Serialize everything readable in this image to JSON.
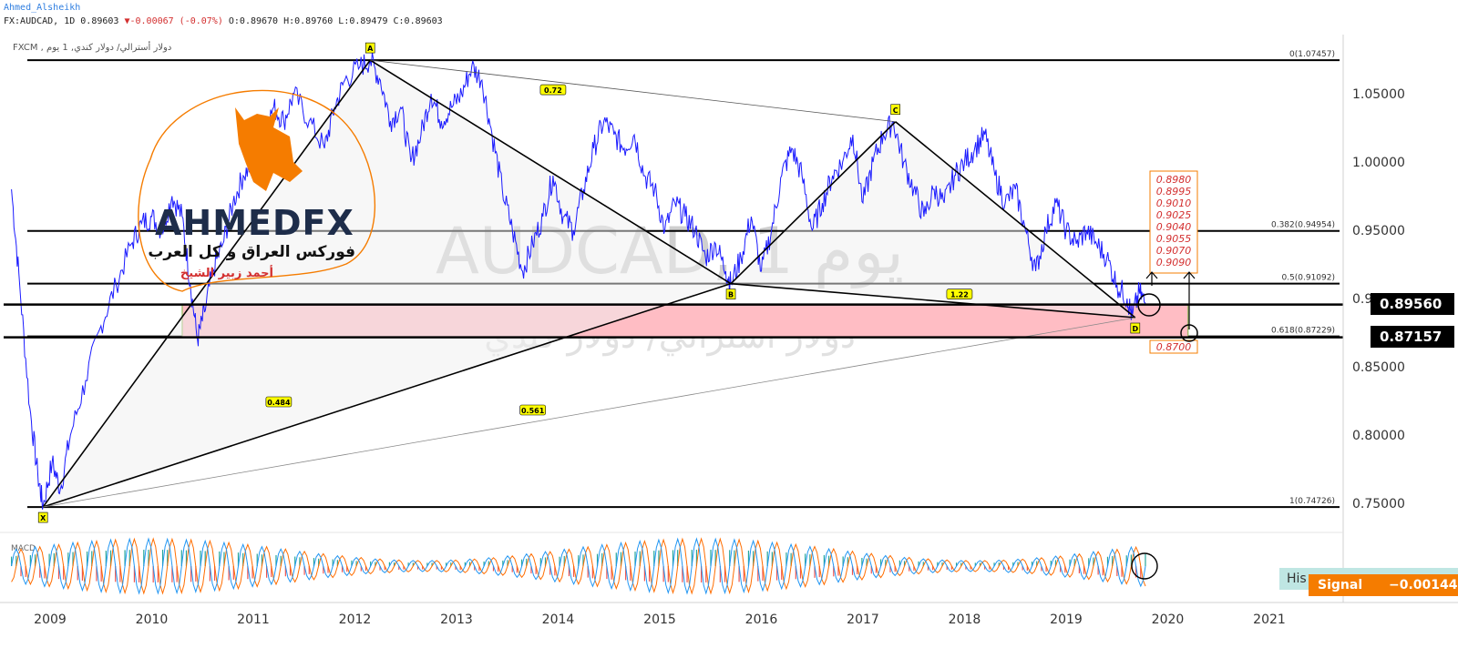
{
  "header": {
    "author": "Ahmed_Alsheikh",
    "symbol_line": "FX:AUDCAD, 1D 0.89603",
    "change_glyph": "▼",
    "change": "-0.00067 (-0.07%)",
    "ohlc": "O:0.89670 H:0.89760 L:0.89479 C:0.89603",
    "source_line": "FXCM , دولار أسترالي/ دولار كندي, 1 يوم"
  },
  "watermark": {
    "main": "AUDCAD, 1 يوم",
    "sub": "دولار أسترالي/ دولار كندي"
  },
  "logo": {
    "brand": "AHMEDFX",
    "tagline": "فوركس العراق و كل العرب",
    "name": "أحمد زبير الشيخ"
  },
  "colors": {
    "price_line": "#1a1aff",
    "zone_fill": "#ffbdc4",
    "macd_line": "#2196f3",
    "signal_line": "#ff6d00",
    "hist_up": "#26a69a",
    "hist_down": "#ef5350",
    "logo_orange": "#f57c00",
    "ratio_label_bg": "#ffff00"
  },
  "chart_data": {
    "type": "line",
    "symbol": "FX:AUDCAD",
    "timeframe": "1D",
    "x_ticks": [
      "2009",
      "2010",
      "2011",
      "2012",
      "2013",
      "2014",
      "2015",
      "2016",
      "2017",
      "2018",
      "2019",
      "2020",
      "2021"
    ],
    "y_ticks": [
      "1.05000",
      "1.00000",
      "0.95000",
      "0.90000",
      "0.85000",
      "0.80000",
      "0.75000"
    ],
    "ylim": [
      0.72,
      1.085
    ],
    "series": [
      {
        "key": "price",
        "points": [
          [
            2008.62,
            0.98
          ],
          [
            2008.7,
            0.91
          ],
          [
            2008.8,
            0.82
          ],
          [
            2008.88,
            0.77
          ],
          [
            2008.93,
            0.748
          ],
          [
            2009.02,
            0.78
          ],
          [
            2009.1,
            0.76
          ],
          [
            2009.2,
            0.8
          ],
          [
            2009.35,
            0.84
          ],
          [
            2009.5,
            0.88
          ],
          [
            2009.65,
            0.91
          ],
          [
            2009.8,
            0.94
          ],
          [
            2009.9,
            0.955
          ],
          [
            2010.0,
            0.96
          ],
          [
            2010.1,
            0.95
          ],
          [
            2010.2,
            0.975
          ],
          [
            2010.3,
            0.96
          ],
          [
            2010.38,
            0.91
          ],
          [
            2010.45,
            0.87
          ],
          [
            2010.52,
            0.89
          ],
          [
            2010.6,
            0.92
          ],
          [
            2010.7,
            0.94
          ],
          [
            2010.8,
            0.97
          ],
          [
            2010.9,
            0.99
          ],
          [
            2011.0,
            1.0
          ],
          [
            2011.1,
            1.02
          ],
          [
            2011.2,
            1.04
          ],
          [
            2011.3,
            1.03
          ],
          [
            2011.4,
            1.05
          ],
          [
            2011.55,
            1.03
          ],
          [
            2011.7,
            1.01
          ],
          [
            2011.8,
            1.04
          ],
          [
            2011.9,
            1.06
          ],
          [
            2012.05,
            1.07
          ],
          [
            2012.15,
            1.0745
          ],
          [
            2012.25,
            1.06
          ],
          [
            2012.35,
            1.03
          ],
          [
            2012.45,
            1.04
          ],
          [
            2012.55,
            1.0
          ],
          [
            2012.65,
            1.02
          ],
          [
            2012.75,
            1.05
          ],
          [
            2012.85,
            1.03
          ],
          [
            2012.95,
            1.04
          ],
          [
            2013.05,
            1.05
          ],
          [
            2013.15,
            1.07
          ],
          [
            2013.25,
            1.06
          ],
          [
            2013.35,
            1.02
          ],
          [
            2013.45,
            0.98
          ],
          [
            2013.55,
            0.95
          ],
          [
            2013.65,
            0.92
          ],
          [
            2013.75,
            0.94
          ],
          [
            2013.85,
            0.96
          ],
          [
            2013.95,
            0.99
          ],
          [
            2014.05,
            0.96
          ],
          [
            2014.15,
            0.95
          ],
          [
            2014.25,
            0.98
          ],
          [
            2014.35,
            1.01
          ],
          [
            2014.45,
            1.03
          ],
          [
            2014.55,
            1.02
          ],
          [
            2014.65,
            1.01
          ],
          [
            2014.75,
            1.02
          ],
          [
            2014.85,
            0.99
          ],
          [
            2014.95,
            0.98
          ],
          [
            2015.05,
            0.95
          ],
          [
            2015.15,
            0.97
          ],
          [
            2015.25,
            0.96
          ],
          [
            2015.35,
            0.95
          ],
          [
            2015.45,
            0.93
          ],
          [
            2015.55,
            0.94
          ],
          [
            2015.65,
            0.92
          ],
          [
            2015.7,
            0.9109
          ],
          [
            2015.8,
            0.93
          ],
          [
            2015.9,
            0.96
          ],
          [
            2016.0,
            0.92
          ],
          [
            2016.1,
            0.95
          ],
          [
            2016.2,
            0.99
          ],
          [
            2016.3,
            1.01
          ],
          [
            2016.4,
            0.99
          ],
          [
            2016.5,
            0.95
          ],
          [
            2016.6,
            0.97
          ],
          [
            2016.7,
            0.99
          ],
          [
            2016.8,
            1.0
          ],
          [
            2016.9,
            1.02
          ],
          [
            2017.0,
            0.97
          ],
          [
            2017.1,
            1.0
          ],
          [
            2017.2,
            1.02
          ],
          [
            2017.3,
            1.0295
          ],
          [
            2017.4,
            1.0
          ],
          [
            2017.5,
            0.98
          ],
          [
            2017.6,
            0.96
          ],
          [
            2017.7,
            0.98
          ],
          [
            2017.8,
            0.97
          ],
          [
            2017.9,
            0.99
          ],
          [
            2018.0,
            1.0
          ],
          [
            2018.1,
            1.01
          ],
          [
            2018.2,
            1.02
          ],
          [
            2018.3,
            0.99
          ],
          [
            2018.4,
            0.97
          ],
          [
            2018.5,
            0.98
          ],
          [
            2018.6,
            0.95
          ],
          [
            2018.7,
            0.92
          ],
          [
            2018.8,
            0.95
          ],
          [
            2018.9,
            0.97
          ],
          [
            2019.0,
            0.95
          ],
          [
            2019.1,
            0.94
          ],
          [
            2019.2,
            0.95
          ],
          [
            2019.3,
            0.94
          ],
          [
            2019.4,
            0.93
          ],
          [
            2019.5,
            0.91
          ],
          [
            2019.6,
            0.9
          ],
          [
            2019.65,
            0.887
          ],
          [
            2019.72,
            0.905
          ],
          [
            2019.78,
            0.896
          ]
        ]
      },
      {
        "key": "macd",
        "panel": "MACD",
        "bounds": [
          -1,
          1
        ],
        "cycles": 60
      }
    ],
    "harmonic_pattern": {
      "points": [
        {
          "label": "X",
          "x": 2008.93,
          "y": 0.7473
        },
        {
          "label": "A",
          "x": 2012.15,
          "y": 1.0746
        },
        {
          "label": "B",
          "x": 2015.7,
          "y": 0.9109
        },
        {
          "label": "C",
          "x": 2017.32,
          "y": 1.0295
        },
        {
          "label": "D",
          "x": 2019.68,
          "y": 0.886
        }
      ],
      "ratios": [
        {
          "value": "0.72",
          "x": 2013.95,
          "y": 1.0526
        },
        {
          "value": "0.484",
          "x": 2011.25,
          "y": 0.824
        },
        {
          "value": "0.561",
          "x": 2013.75,
          "y": 0.818
        },
        {
          "value": "1.22",
          "x": 2017.95,
          "y": 0.9029
        }
      ]
    },
    "fib_levels": [
      {
        "label": "0(1.07457)",
        "y": 1.07457
      },
      {
        "label": "0.382(0.94954)",
        "y": 0.94954
      },
      {
        "label": "0.5(0.91092)",
        "y": 0.91092
      },
      {
        "label": "0.618(0.87229)",
        "y": 0.87229
      },
      {
        "label": "1(0.74726)",
        "y": 0.74726
      }
    ],
    "horizontal_lines": [
      {
        "price_label": "0.89560",
        "y": 0.8956
      },
      {
        "price_label": "0.87157",
        "y": 0.87157
      }
    ],
    "target_zone": {
      "y_top": 0.8956,
      "y_bottom": 0.8716,
      "x_start": 2010.3,
      "x_end": 2020.2
    },
    "target_list": [
      "0.8980",
      "0.8995",
      "0.9010",
      "0.9025",
      "0.9040",
      "0.9055",
      "0.9070",
      "0.9090"
    ],
    "target_low": "0.8700",
    "macd_indicator": {
      "label": "MACD",
      "legend_hist": "His",
      "signal_label": "Signal",
      "signal_value": "−0.00144"
    }
  }
}
